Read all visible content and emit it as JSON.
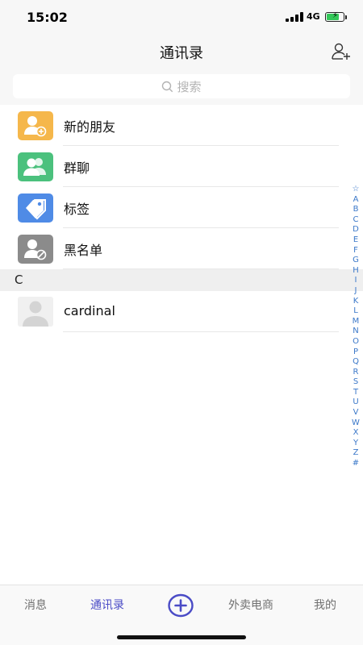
{
  "status": {
    "time": "15:02",
    "network": "4G"
  },
  "header": {
    "title": "通讯录"
  },
  "search": {
    "placeholder": "搜索"
  },
  "features": [
    {
      "label": "新的朋友",
      "color": "#f5b74b",
      "icon": "add-friend-icon"
    },
    {
      "label": "群聊",
      "color": "#4bc17d",
      "icon": "group-icon"
    },
    {
      "label": "标签",
      "color": "#4f8be6",
      "icon": "tag-icon"
    },
    {
      "label": "黑名单",
      "color": "#8b8b8b",
      "icon": "blacklist-icon"
    }
  ],
  "sections": [
    {
      "letter": "C",
      "contacts": [
        {
          "name": "cardinal"
        }
      ]
    }
  ],
  "index": [
    "☆",
    "A",
    "B",
    "C",
    "D",
    "E",
    "F",
    "G",
    "H",
    "I",
    "J",
    "K",
    "L",
    "M",
    "N",
    "O",
    "P",
    "Q",
    "R",
    "S",
    "T",
    "U",
    "V",
    "W",
    "X",
    "Y",
    "Z",
    "#"
  ],
  "tabs": [
    {
      "label": "消息",
      "active": false
    },
    {
      "label": "通讯录",
      "active": true
    },
    {
      "label": "外卖电商",
      "active": false
    },
    {
      "label": "我的",
      "active": false
    }
  ],
  "colors": {
    "accent": "#4a4bc6",
    "index": "#3b78c9"
  }
}
